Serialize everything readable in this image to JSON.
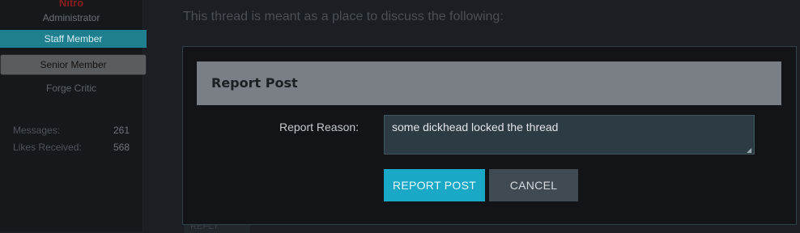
{
  "sidebar": {
    "username": "Nitro",
    "user_title": "Administrator",
    "banner_staff": "Staff Member",
    "banner_senior": "Senior Member",
    "forge_critic": "Forge Critic",
    "stats": [
      {
        "label": "Messages:",
        "value": "261"
      },
      {
        "label": "Likes Received:",
        "value": "568"
      }
    ]
  },
  "thread": {
    "intro_text": "This thread is meant as a place to discuss the following:",
    "reply_label": "REPLY"
  },
  "dialog": {
    "title": "Report Post",
    "reason_label": "Report Reason:",
    "reason_value": "some dickhead locked the thread",
    "report_button": "REPORT POST",
    "cancel_button": "CANCEL"
  },
  "colors": {
    "accent": "#1aa8c7",
    "staff_banner": "#1e7f8f",
    "username": "#8a1d1d"
  }
}
